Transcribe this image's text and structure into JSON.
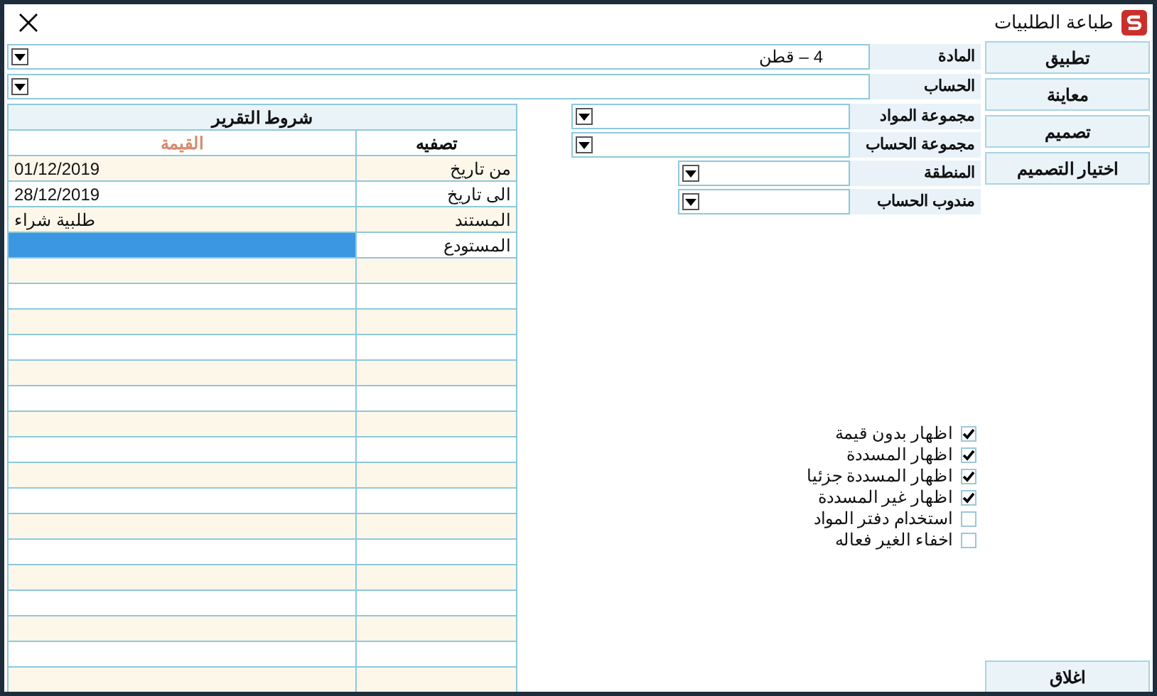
{
  "window": {
    "title": "طباعة الطلبيات"
  },
  "fields": [
    {
      "label": "المادة",
      "value": "4 – قطن"
    },
    {
      "label": "الحساب"
    }
  ],
  "groups": [
    {
      "label": "مجموعة المواد"
    },
    {
      "label": "مجموعة الحساب"
    }
  ],
  "filters": [
    {
      "label": "المنطقة"
    },
    {
      "label": "مندوب الحساب"
    }
  ],
  "conditions": {
    "title": "شروط التقرير",
    "columns": [
      "تصفيه",
      "القيمة"
    ],
    "rows": [
      {
        "filter": "من تاريخ",
        "value": "01/12/2019",
        "selected": false
      },
      {
        "filter": "الى تاريخ",
        "value": "28/12/2019",
        "selected": false
      },
      {
        "filter": "المستند",
        "value": "طلبية شراء",
        "selected": false
      },
      {
        "filter": "المستودع",
        "selected": true
      }
    ]
  },
  "options": [
    {
      "label": "اظهار بدون قيمة",
      "checked": true
    },
    {
      "label": "اظهار المسددة",
      "checked": true
    },
    {
      "label": "اظهار المسددة جزئيا",
      "checked": true
    },
    {
      "label": "اظهار غير المسددة",
      "checked": true
    },
    {
      "label": "استخدام دفتر المواد",
      "checked": false
    },
    {
      "label": "اخفاء الغير فعاله",
      "checked": false
    }
  ],
  "buttons": [
    "تطبيق",
    "معاينة",
    "تصميم",
    "اختيار التصميم"
  ],
  "close_button": "اغلاق"
}
